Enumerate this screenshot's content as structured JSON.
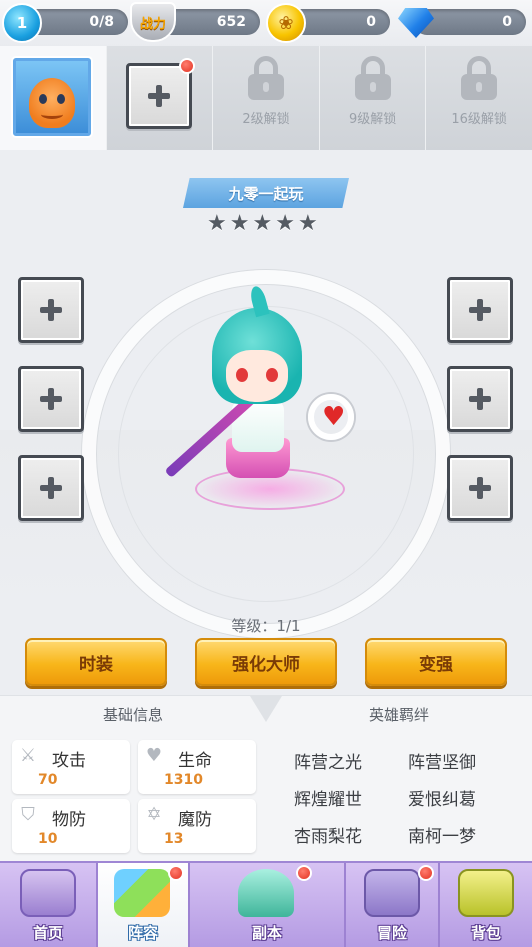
{
  "topbar": {
    "level_badge": "1",
    "level_count": "0/8",
    "power_badge": "战力",
    "power_value": "652",
    "gold_value": "0",
    "gem_value": "0"
  },
  "slots": [
    {
      "type": "hero",
      "icon": "charmander-portrait"
    },
    {
      "type": "add",
      "has_notice": true
    },
    {
      "type": "locked",
      "label": "2级解锁"
    },
    {
      "type": "locked",
      "label": "9级解锁"
    },
    {
      "type": "locked",
      "label": "16级解锁"
    }
  ],
  "hero": {
    "name": "九零一起玩",
    "stars": [
      "★",
      "★",
      "★",
      "★",
      "★"
    ],
    "level_text": "等级：1/1"
  },
  "buttons": {
    "fashion": "时装",
    "master": "强化大师",
    "strengthen": "变强"
  },
  "info": {
    "basic_title": "基础信息",
    "bond_title": "英雄羁绊",
    "stats": [
      {
        "icon": "sword-icon",
        "label": "攻击",
        "value": "70"
      },
      {
        "icon": "heart-icon",
        "label": "生命",
        "value": "1310"
      },
      {
        "icon": "shield-icon",
        "label": "物防",
        "value": "10"
      },
      {
        "icon": "magic-star-icon",
        "label": "魔防",
        "value": "13"
      }
    ],
    "bonds": [
      "阵营之光",
      "阵营坚御",
      "辉煌耀世",
      "爱恨纠葛",
      "杏雨梨花",
      "南柯一梦"
    ]
  },
  "nav": [
    {
      "label": "首页",
      "active": false,
      "notice": false,
      "icon": "gamepad-icon"
    },
    {
      "label": "阵容",
      "active": true,
      "notice": true,
      "icon": "cube-icon"
    },
    {
      "label": "副本",
      "active": false,
      "notice": true,
      "icon": "crystal-icon"
    },
    {
      "label": "冒险",
      "active": false,
      "notice": true,
      "icon": "treasure-icon"
    },
    {
      "label": "背包",
      "active": false,
      "notice": false,
      "icon": "backpack-icon"
    }
  ],
  "colors": {
    "accent_gold": "#f8b61a",
    "name_banner": "#5ca3e0",
    "stat_value": "#e2882a",
    "nav_bg": "#b49be3",
    "notice_red": "#e23222"
  }
}
